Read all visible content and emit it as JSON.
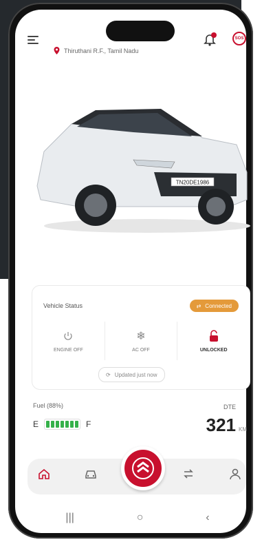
{
  "header": {
    "location": "Thiruthani R.F., Tamil Nadu",
    "sos_label": "SOS",
    "notification_badge": "1"
  },
  "vehicle_status": {
    "title": "Vehicle Status",
    "connection": "Connected",
    "engine": "ENGINE OFF",
    "ac": "AC OFF",
    "lock": "UNLOCKED",
    "updated": "Updated just now",
    "plate": "TN20DE1986"
  },
  "fuel": {
    "label": "Fuel (88%)",
    "level_percent": 88,
    "empty": "E",
    "full": "F"
  },
  "dte": {
    "label": "DTE",
    "value": "321",
    "unit": "KM"
  },
  "colors": {
    "brand": "#c8102e",
    "connected": "#e49a3a",
    "fuel": "#35b14a"
  },
  "nav": {
    "items": [
      "home-icon",
      "car-icon",
      "brand-logo",
      "swap-icon",
      "profile-icon"
    ]
  },
  "system_nav": {
    "recent": "|||",
    "home": "○",
    "back": "‹"
  }
}
